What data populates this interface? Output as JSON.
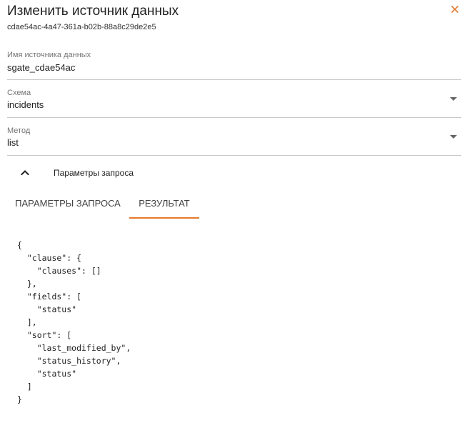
{
  "dialog": {
    "title": "Изменить источник данных",
    "id": "cdae54ac-4a47-361a-b02b-88a8c29de2e5"
  },
  "fields": {
    "name": {
      "label": "Имя источника данных",
      "value": "sgate_cdae54ac"
    },
    "schema": {
      "label": "Схема",
      "value": "incidents"
    },
    "method": {
      "label": "Метод",
      "value": "list"
    }
  },
  "section": {
    "title": "Параметры запроса",
    "expanded": true
  },
  "tabs": {
    "params_label": "ПАРАМЕТРЫ ЗАПРОСА",
    "result_label": "РЕЗУЛЬТАТ",
    "active": "result"
  },
  "result_json": "{\n  \"clause\": {\n    \"clauses\": []\n  },\n  \"fields\": [\n    \"status\"\n  ],\n  \"sort\": [\n    \"last_modified_by\",\n    \"status_history\",\n    \"status\"\n  ]\n}",
  "colors": {
    "accent": "#e8792b",
    "divider": "#c8c8c8",
    "label": "#757575"
  },
  "icons": {
    "close": "close-icon",
    "dropdown": "dropdown-arrow-icon",
    "collapse": "chevron-up-icon"
  }
}
